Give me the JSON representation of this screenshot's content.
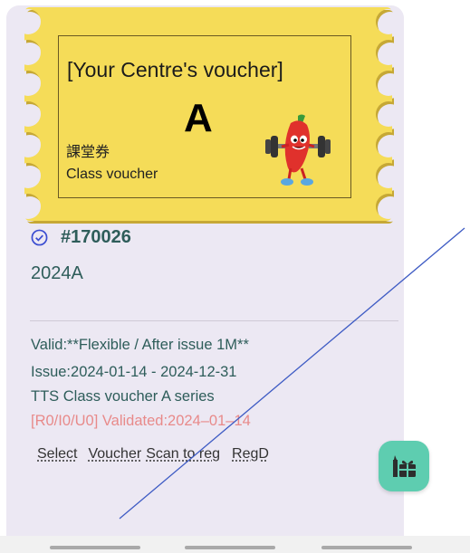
{
  "voucher_card": {
    "title": "[Your Centre's voucher]",
    "letter": "A",
    "label_zh": "課堂券",
    "label_en": "Class voucher",
    "ticket_color": "#f5dc58",
    "mascot": "dumbbell-lifting-chili-mascot"
  },
  "details": {
    "voucher_number": "#170026",
    "series": "2024A",
    "validity": "Valid:**Flexible / After issue 1M**",
    "issue_period": "Issue:2024-01-14 - 2024-12-31",
    "description": "TTS Class voucher A series",
    "validation_status": "[R0/I0/U0] Validated:2024–01–14",
    "validation_color": "#e88a8a",
    "accent_color": "#2e5d5a"
  },
  "actions": {
    "select": "Select",
    "voucher": "Voucher",
    "scan_to_reg": "Scan to reg",
    "regd": "RegD"
  },
  "fab": {
    "icon": "gift-icon",
    "color": "#5ecdb0"
  }
}
